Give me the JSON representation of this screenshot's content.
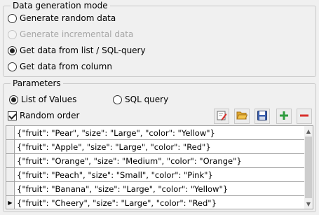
{
  "mode_group": {
    "title": "Data generation mode",
    "options": [
      {
        "label": "Generate random data",
        "checked": false,
        "disabled": false
      },
      {
        "label": "Generate incremental data",
        "checked": false,
        "disabled": true
      },
      {
        "label": "Get data from list / SQL-query",
        "checked": true,
        "disabled": false
      },
      {
        "label": "Get data from column",
        "checked": false,
        "disabled": false
      }
    ]
  },
  "params_group": {
    "title": "Parameters",
    "list_of_values": "List of Values",
    "sql_query": "SQL query",
    "random_order": "Random order"
  },
  "toolbar": {
    "icons": [
      "edit-icon",
      "open-folder-icon",
      "save-icon",
      "add-icon",
      "remove-icon"
    ]
  },
  "grid": {
    "rows": [
      "{\"fruit\": \"Pear\", \"size\": \"Large\", \"color\": \"Yellow\"}",
      "{\"fruit\": \"Apple\", \"size\": \"Large\", \"color\": \"Red\"}",
      "{\"fruit\": \"Orange\", \"size\": \"Medium\", \"color\": \"Orange\"}",
      "{\"fruit\": \"Peach\", \"size\": \"Small\", \"color\": \"Pink\"}",
      "{\"fruit\": \"Banana\", \"size\": \"Large\", \"color\": \"Yellow\"}",
      "{\"fruit\": \"Cheery\", \"size\": \"Large\", \"color\": \"Red\"}"
    ],
    "current_row": 5
  },
  "colors": {
    "add": "#2e9b3e",
    "remove": "#d9302c",
    "save": "#3b5fae"
  }
}
